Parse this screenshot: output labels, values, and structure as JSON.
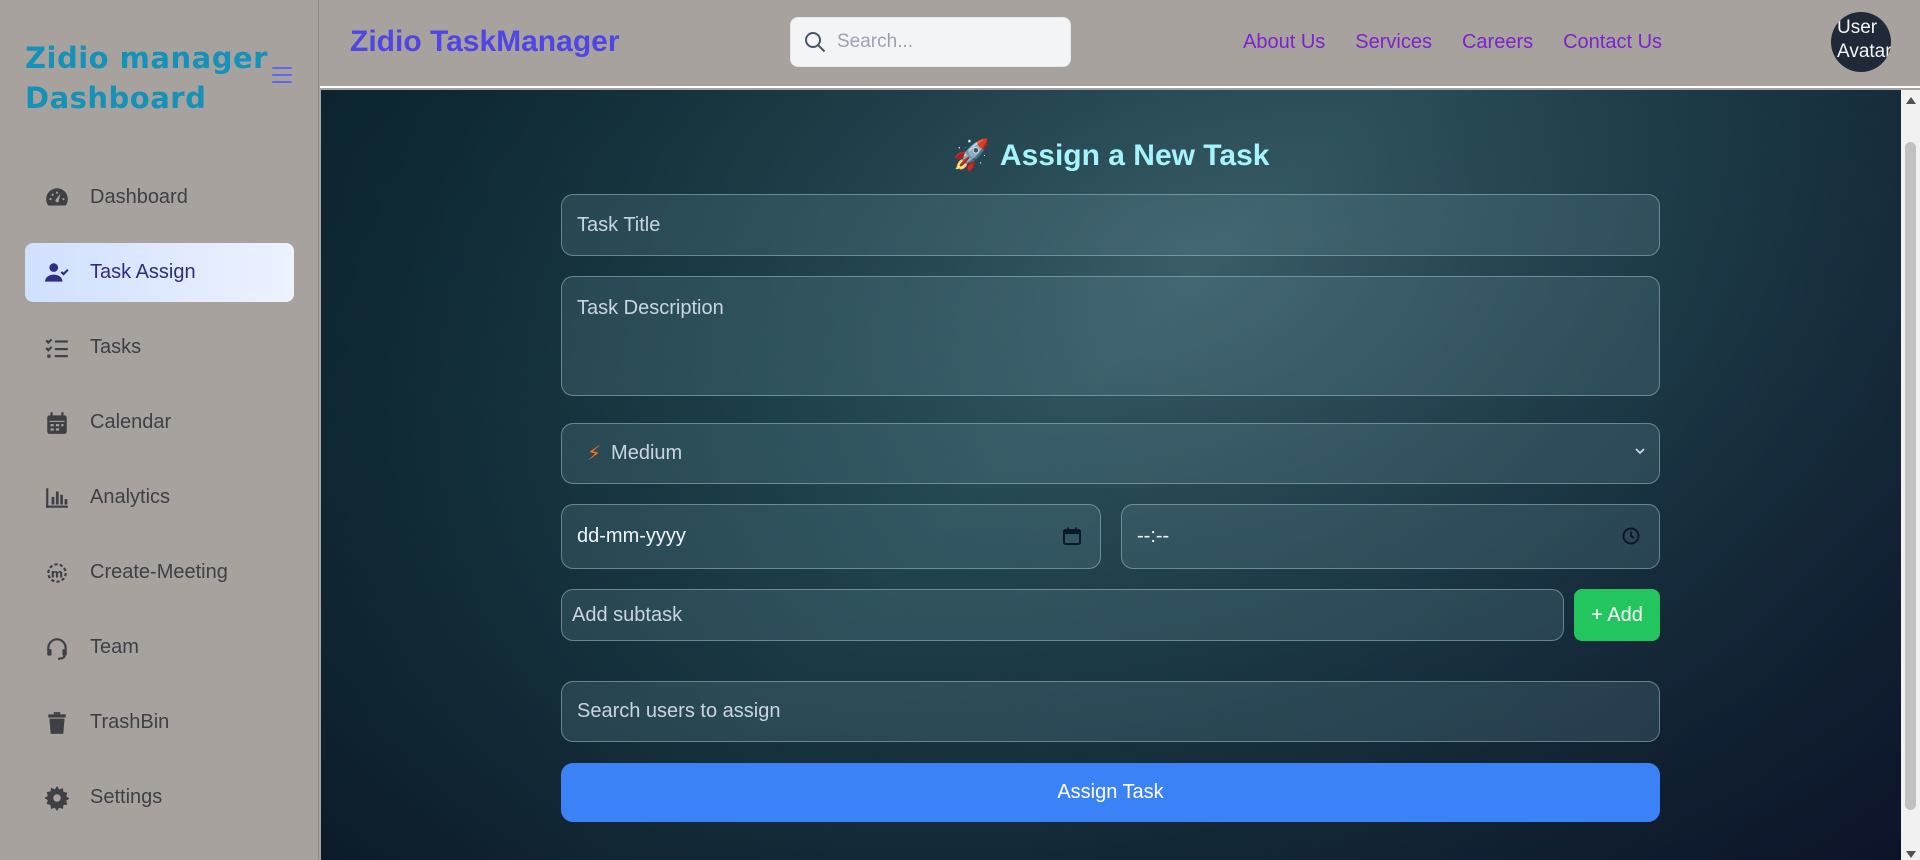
{
  "sidebar": {
    "brand_line1": "Zidio manager",
    "brand_line2": "Dashboard",
    "items": [
      {
        "label": "Dashboard",
        "icon": "gauge-icon"
      },
      {
        "label": "Task Assign",
        "icon": "user-check-icon",
        "active": true
      },
      {
        "label": "Tasks",
        "icon": "list-check-icon"
      },
      {
        "label": "Calendar",
        "icon": "calendar-icon"
      },
      {
        "label": "Analytics",
        "icon": "bar-chart-icon"
      },
      {
        "label": "Create-Meeting",
        "icon": "meeting-icon"
      },
      {
        "label": "Team",
        "icon": "headset-icon"
      },
      {
        "label": "TrashBin",
        "icon": "trash-icon"
      },
      {
        "label": "Settings",
        "icon": "gear-icon"
      }
    ]
  },
  "header": {
    "title": "Zidio TaskManager",
    "search_placeholder": "Search...",
    "links": [
      "About Us",
      "Services",
      "Careers",
      "Contact Us"
    ],
    "avatar_alt": "User Avatar"
  },
  "form": {
    "title": "Assign a New Task",
    "title_icon": "🚀",
    "task_title_placeholder": "Task Title",
    "task_description_placeholder": "Task Description",
    "priority_icon": "⚡",
    "priority_value": "Medium",
    "date_value": "dd-mm-yyyy",
    "time_value": "--:--",
    "subtask_placeholder": "Add subtask",
    "add_button": "+ Add",
    "users_placeholder": "Search users to assign",
    "assign_button": "Assign Task"
  },
  "colors": {
    "brand": "#1592b8",
    "app_title": "#4f46e5",
    "links": "#7e22ce",
    "form_title": "#a5f3fc",
    "add_button": "#22c55e",
    "assign_button": "#3b82f6"
  }
}
